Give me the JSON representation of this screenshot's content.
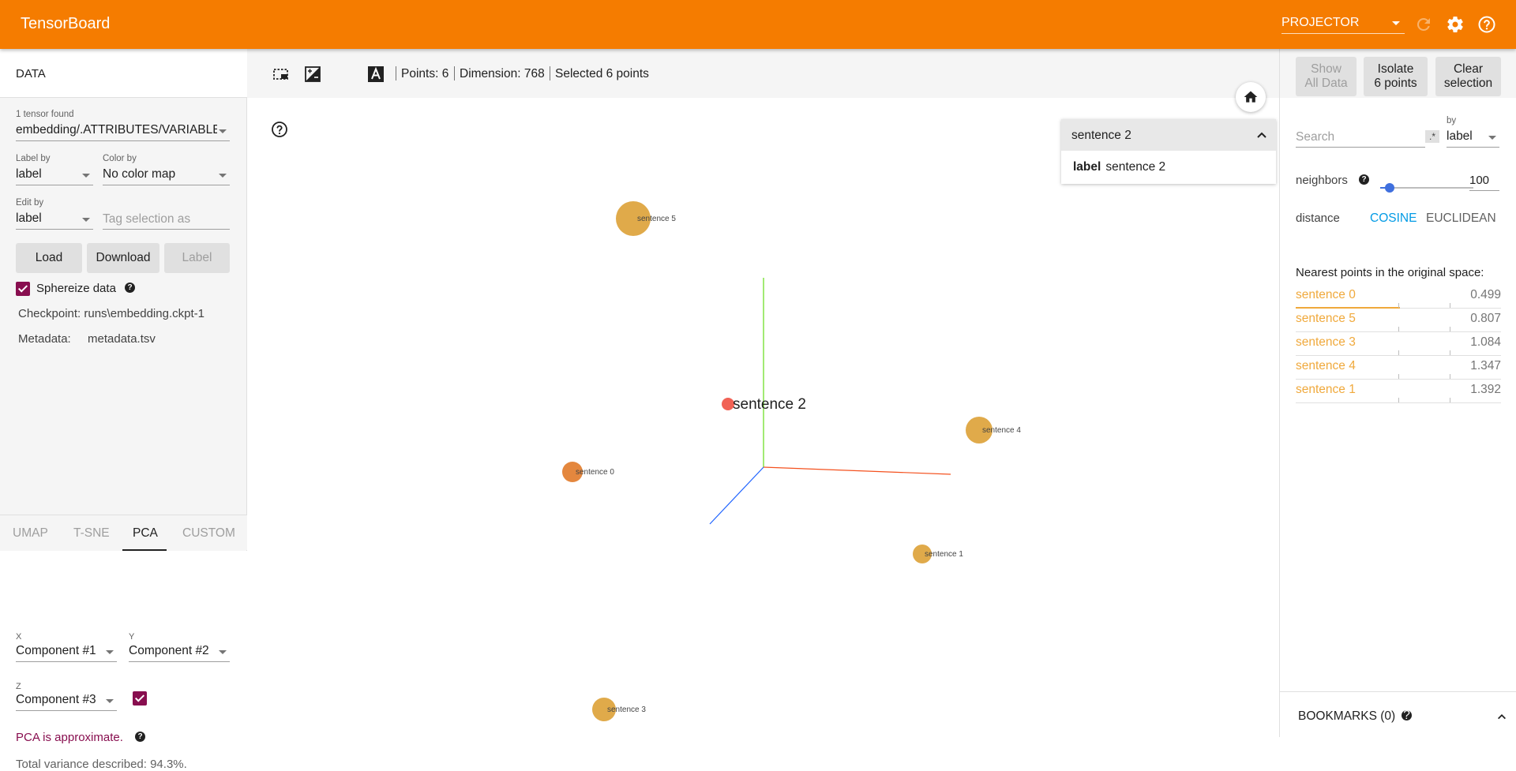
{
  "app": {
    "title": "TensorBoard",
    "plugin": "PROJECTOR"
  },
  "left": {
    "header": "DATA",
    "tensor_caption": "1 tensor found",
    "tensor_name": "embedding/.ATTRIBUTES/VARIABLE_VALUE",
    "label_by_caption": "Label by",
    "label_by": "label",
    "color_by_caption": "Color by",
    "color_by": "No color map",
    "edit_by_caption": "Edit by",
    "edit_by": "label",
    "tag_placeholder": "Tag selection as",
    "load_label": "Load",
    "download_label": "Download",
    "label_button": "Label",
    "sphereize_label": "Sphereize data",
    "sphereize_checked": true,
    "checkpoint_text": "Checkpoint: runs\\embedding.ckpt-1",
    "metadata_label": "Metadata:",
    "metadata_value": "metadata.tsv",
    "tabs": [
      "UMAP",
      "T-SNE",
      "PCA",
      "CUSTOM"
    ],
    "active_tab": "PCA",
    "pca": {
      "x_caption": "X",
      "x_value": "Component #1",
      "y_caption": "Y",
      "y_value": "Component #2",
      "z_caption": "Z",
      "z_value": "Component #3",
      "z_enabled": true,
      "approx_note": "PCA is approximate.",
      "variance_text": "Total variance described: 94.3%."
    }
  },
  "toolbar": {
    "points": "Points: 6",
    "dimension": "Dimension: 768",
    "selected": "Selected 6 points"
  },
  "inspect": {
    "title": "sentence 2",
    "key": "label",
    "value": "sentence 2"
  },
  "scene": {
    "selected_label": "sentence 2",
    "points": [
      {
        "label": "sentence 5",
        "color": "#e0aa4a"
      },
      {
        "label": "sentence 4",
        "color": "#e0aa4a"
      },
      {
        "label": "sentence 0",
        "color": "#e4873e"
      },
      {
        "label": "sentence 1",
        "color": "#e0aa4a"
      },
      {
        "label": "sentence 3",
        "color": "#e0aa4a"
      },
      {
        "label": "sentence 2",
        "color": "#f16255"
      }
    ],
    "axis_colors": {
      "x": "#f4511e",
      "y": "#64dd17",
      "z": "#1e63ff"
    }
  },
  "right": {
    "show_all_label_1": "Show",
    "show_all_label_2": "All Data",
    "isolate_label_1": "Isolate",
    "isolate_label_2": "6 points",
    "clear_label_1": "Clear",
    "clear_label_2": "selection",
    "search_placeholder": "Search",
    "regex_label": ".*",
    "by_caption": "by",
    "by_value": "label",
    "neighbors_label": "neighbors",
    "neighbors_value": "100",
    "neighbors_fraction": 0.1,
    "distance_label": "distance",
    "cosine_label": "COSINE",
    "euclidean_label": "EUCLIDEAN",
    "nearest_title": "Nearest points in the original space:",
    "nearest": [
      {
        "name": "sentence 0",
        "value": "0.499"
      },
      {
        "name": "sentence 5",
        "value": "0.807"
      },
      {
        "name": "sentence 3",
        "value": "1.084"
      },
      {
        "name": "sentence 4",
        "value": "1.347"
      },
      {
        "name": "sentence 1",
        "value": "1.392"
      }
    ],
    "bookmarks_label": "BOOKMARKS (0)"
  },
  "colors": {
    "brand": "#f57c00",
    "accent": "#880e4f",
    "link": "#039be5",
    "neighbor": "#f0a93c"
  }
}
